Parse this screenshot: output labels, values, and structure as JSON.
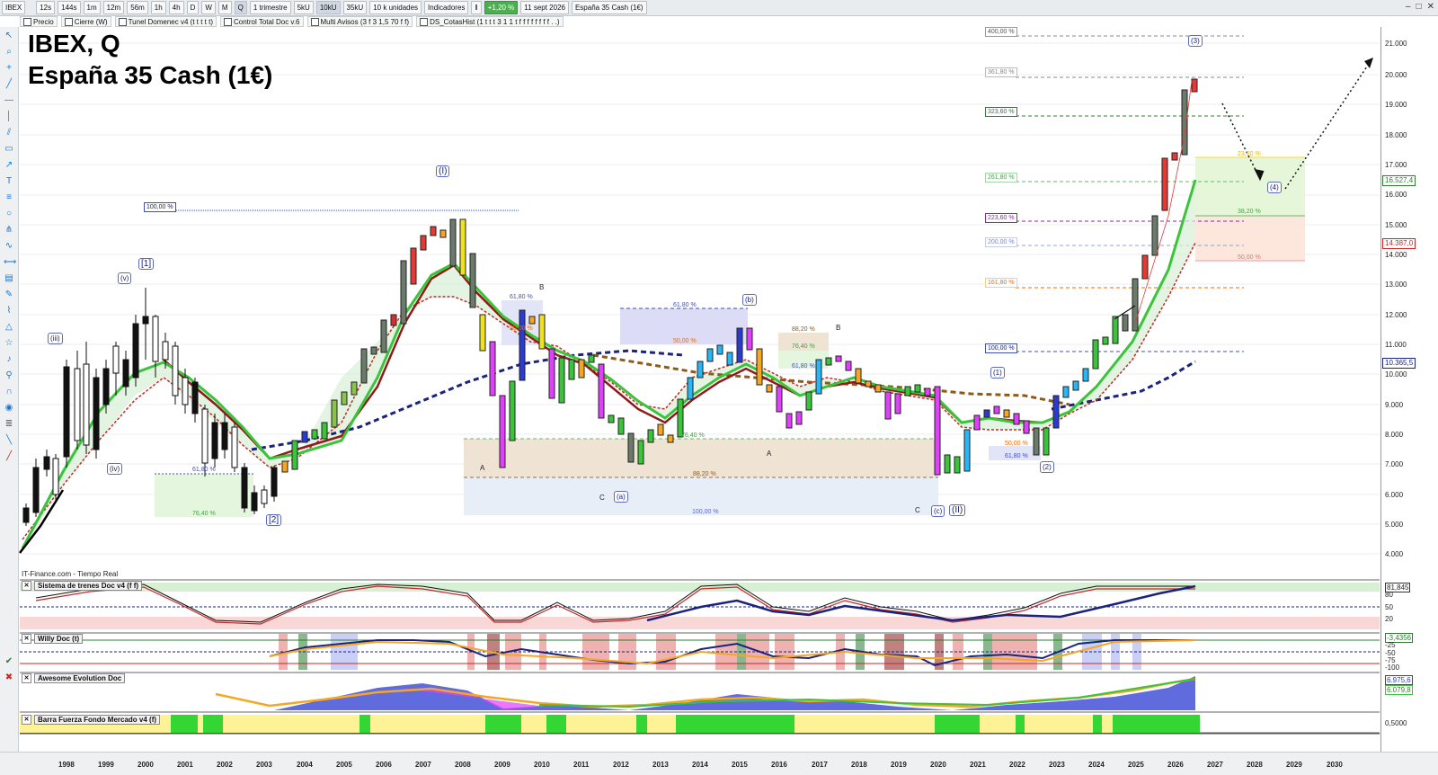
{
  "toolbar": {
    "symbol": "IBEX",
    "timeframes": [
      "12s",
      "144s",
      "1m",
      "12m",
      "56m",
      "1h",
      "4h",
      "D",
      "W",
      "M",
      "Q"
    ],
    "selected_timeframe": "Q",
    "period": "1 trimestre",
    "units": [
      "5kU",
      "10kU",
      "35kU"
    ],
    "selected_unit": "10kU",
    "units_select": "10 k unidades",
    "indicators_label": "Indicadores",
    "change_badge": "+1,20 %",
    "date": "11 sept 2026",
    "instrument": "España 35 Cash (1€)"
  },
  "series_bar": {
    "items": [
      "Precio",
      "Cierre (W)",
      "Tunel Domenec v4 (t t t t t)",
      "Control Total Doc v.6",
      "Multi Avisos (3 f 3 1,5 70 f f)",
      "DS_CotasHist (1 t t t 3 1 1 t f f f f f f f f . .)"
    ]
  },
  "chart": {
    "title_line1": "IBEX, Q",
    "title_line2": "España 35 Cash (1€)",
    "source": "IT-Finance.com - Tiempo Real"
  },
  "price_axis": {
    "ticks": [
      "21.000",
      "20.000",
      "19.000",
      "18.000",
      "17.000",
      "16.000",
      "15.000",
      "14.000",
      "13.000",
      "12.000",
      "11.000",
      "10.000",
      "9.000",
      "8.000",
      "7.000",
      "6.000",
      "5.000",
      "4.000"
    ],
    "tags": [
      {
        "text": "16.527,4",
        "color": "#2e7d32"
      },
      {
        "text": "14.387,0",
        "color": "#c62828"
      },
      {
        "text": "10.365,5",
        "color": "#1a237e"
      }
    ]
  },
  "time_axis": {
    "years": [
      "1998",
      "1999",
      "2000",
      "2001",
      "2002",
      "2003",
      "2004",
      "2005",
      "2006",
      "2007",
      "2008",
      "2009",
      "2010",
      "2011",
      "2012",
      "2013",
      "2014",
      "2015",
      "2016",
      "2017",
      "2018",
      "2019",
      "2020",
      "2021",
      "2022",
      "2023",
      "2024",
      "2025",
      "2026",
      "2027",
      "2028",
      "2029",
      "2030"
    ]
  },
  "waves": [
    "(iii)",
    "(iv)",
    "(v)",
    "[1]",
    "[2]",
    "(I)",
    "(a)",
    "(b)",
    "(c)",
    "(II)",
    "(1)",
    "(2)",
    "(3)",
    "(4)"
  ],
  "wave_letters": [
    "A",
    "B",
    "C",
    "A",
    "B",
    "C"
  ],
  "fib_labels": [
    "100,00 %",
    "61,80 %",
    "76,40 %",
    "61,80 %",
    "50,00 %",
    "61,80 %",
    "50,00 %",
    "76,40 %",
    "88,20 %",
    "100,00 %",
    "88,20 %",
    "76,40 %",
    "61,80 %",
    "50,00 %",
    "61,80 %",
    "400,00 %",
    "361,80 %",
    "323,60 %",
    "261,80 %",
    "223,60 %",
    "200,00 %",
    "161,80 %",
    "100,00 %",
    "23,60 %",
    "38,20 %",
    "50,00 %"
  ],
  "panels": [
    {
      "name": "Sistema de trenes Doc v4 (f f)",
      "axis": [
        "81,845",
        "80",
        "50",
        "20"
      ]
    },
    {
      "name": "Willy Doc (t)",
      "axis": [
        "-3,4356",
        "-25",
        "-50",
        "-75",
        "-100"
      ]
    },
    {
      "name": "Awesome Evolution Doc",
      "axis": [
        "6.975,6",
        "6.079,8"
      ]
    },
    {
      "name": "Barra Fuerza Fondo Mercado v4 (f)",
      "axis": [
        "0,5000"
      ]
    }
  ]
}
